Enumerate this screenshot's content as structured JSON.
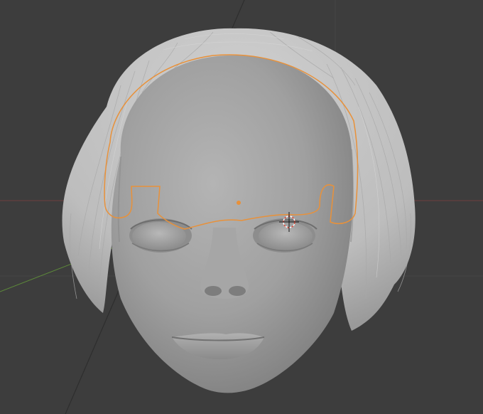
{
  "viewport": {
    "background": "#3d3d3d",
    "grid_color": "#464646",
    "x_axis_color": "#7a3b3b",
    "y_axis_color": "#5d8a3a",
    "selection_outline_color": "#e8913a",
    "origin_color": "#e8913a",
    "object_origin_visible": true,
    "model": {
      "name": "head-sculpt",
      "shading": "solid",
      "base_color": "#9e9e9e",
      "hair_color": "#c8c8c8"
    },
    "selected_object": "eyebrow-outline"
  }
}
